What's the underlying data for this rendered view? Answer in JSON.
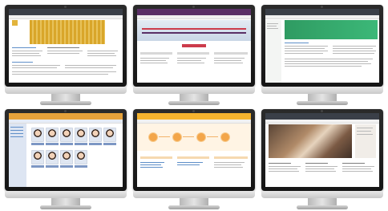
{
  "monitors": [
    {
      "name": "monitor-dashboard",
      "topbar_color": "#3a3f48",
      "hero_color": "#d9a62a",
      "accent": "#e2b43c"
    },
    {
      "name": "monitor-workflow",
      "topbar_color": "#5a2f66",
      "hero_color": "#c9d6e6",
      "accent": "#cc3b4b"
    },
    {
      "name": "monitor-news",
      "topbar_color": "#3a3f48",
      "hero_color": "#2fa36b",
      "accent": "#2f9b62"
    },
    {
      "name": "monitor-directory",
      "topbar_color": "#e6a23a",
      "hero_color": "#e6ecf6",
      "accent": "#7d97c4"
    },
    {
      "name": "monitor-process",
      "topbar_color": "#f5b32e",
      "hero_color": "#fff4e4",
      "accent": "#f3a64a"
    },
    {
      "name": "monitor-portal",
      "topbar_color": "#3a3f48",
      "hero_color": "#8b6a52",
      "accent": "#c46a3f"
    }
  ],
  "icons": [
    "camera-icon",
    "person-photo-icon",
    "step-circle-icon",
    "logo-badge-icon"
  ]
}
